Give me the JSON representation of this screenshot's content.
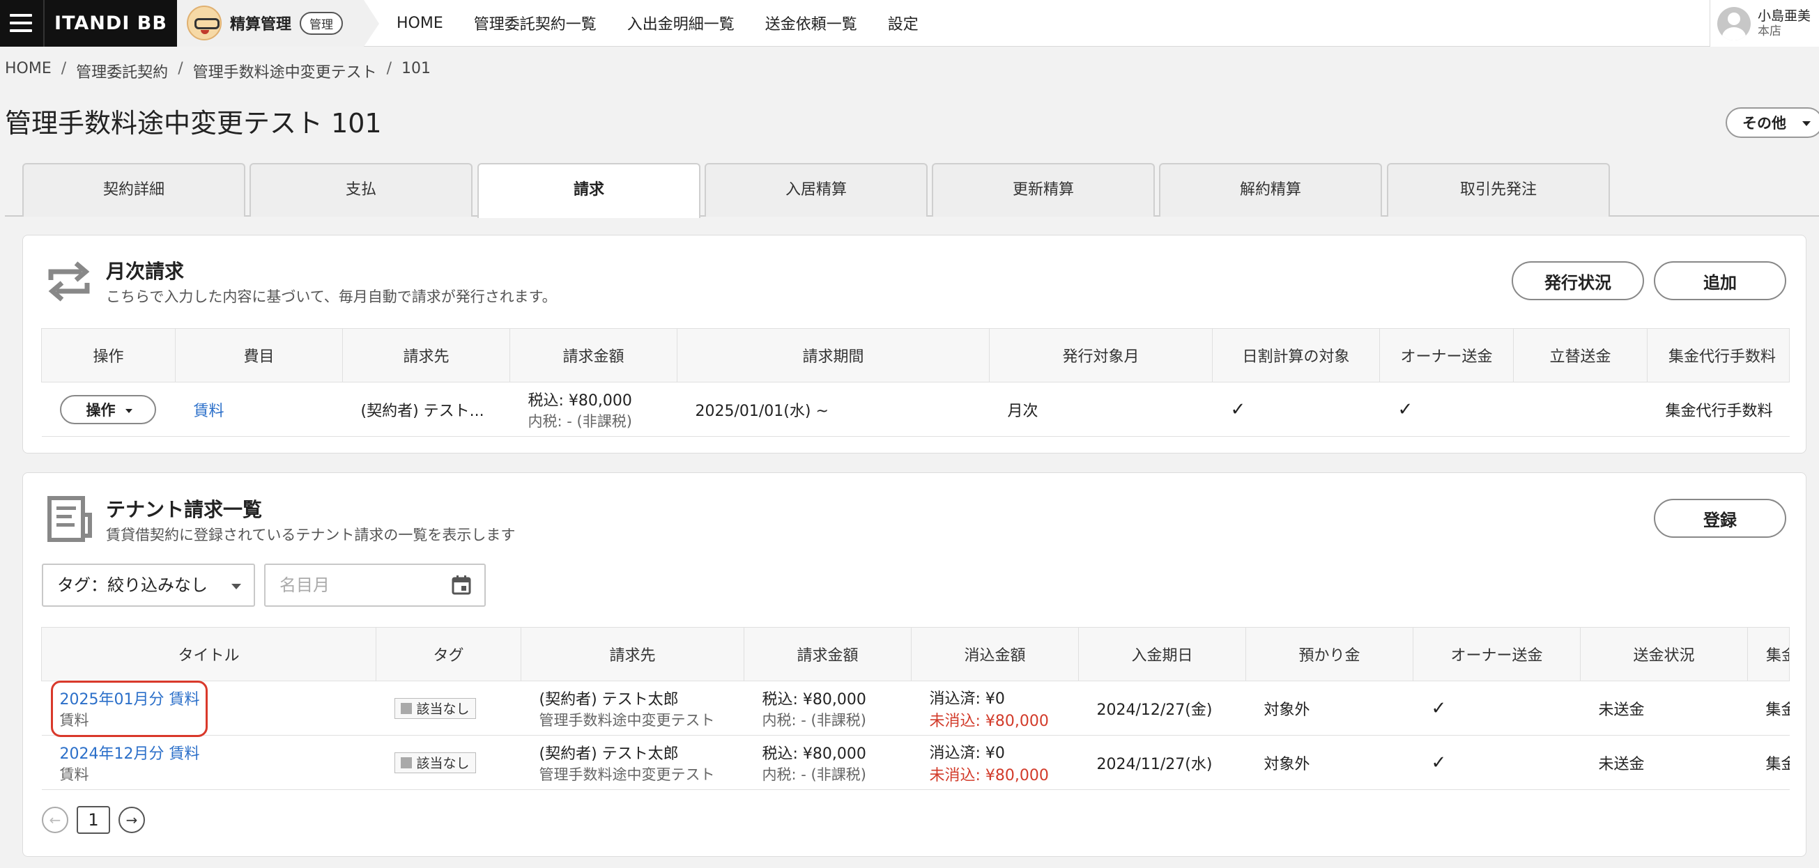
{
  "app": {
    "brand": "ITANDI BB",
    "module_name": "精算管理",
    "module_badge": "管理"
  },
  "topnav": [
    "HOME",
    "管理委託契約一覧",
    "入出金明細一覧",
    "送金依頼一覧",
    "設定"
  ],
  "user": {
    "name": "小島亜美",
    "branch": "本店"
  },
  "breadcrumb": [
    "HOME",
    "管理委託契約",
    "管理手数料途中変更テスト",
    "101"
  ],
  "page_title": "管理手数料途中変更テスト 101",
  "other_button": "その他",
  "tabs": [
    {
      "label": "契約詳細",
      "active": false
    },
    {
      "label": "支払",
      "active": false
    },
    {
      "label": "請求",
      "active": true
    },
    {
      "label": "入居精算",
      "active": false
    },
    {
      "label": "更新精算",
      "active": false
    },
    {
      "label": "解約精算",
      "active": false
    },
    {
      "label": "取引先発注",
      "active": false
    }
  ],
  "monthly": {
    "title": "月次請求",
    "description": "こちらで入力した内容に基づいて、毎月自動で請求が発行されます。",
    "status_button": "発行状況",
    "add_button": "追加",
    "columns": [
      "操作",
      "費目",
      "請求先",
      "請求金額",
      "請求期間",
      "発行対象月",
      "日割計算の対象",
      "オーナー送金",
      "立替送金",
      "集金代行手数料"
    ],
    "row": {
      "ops": "操作",
      "item": "賃料",
      "payer": "(契約者) テスト...",
      "amount": "税込: ¥80,000",
      "amount_sub": "内税: - (非課税)",
      "period": "2025/01/01(水) ~",
      "target_month": "月次",
      "prorate": "✓",
      "owner": "✓",
      "advance": "",
      "fee": "集金代行手数料"
    }
  },
  "tenant": {
    "title": "テナント請求一覧",
    "description": "賃貸借契約に登録されているテナント請求の一覧を表示します",
    "register_button": "登録",
    "tag_filter": "タグ：絞り込みなし",
    "date_placeholder": "名目月",
    "columns": [
      "タイトル",
      "タグ",
      "請求先",
      "請求金額",
      "消込金額",
      "入金期日",
      "預かり金",
      "オーナー送金",
      "送金状況",
      "集金"
    ],
    "rows": [
      {
        "title": "2025年01月分 賃料",
        "title_sub": "賃料",
        "tag": "該当なし",
        "payer": "(契約者) テスト太郎",
        "payer_sub": "管理手数料途中変更テスト",
        "amount": "税込: ¥80,000",
        "amount_sub": "内税: - (非課税)",
        "cleared": "消込済: ¥0",
        "uncleared": "未消込: ¥80,000",
        "due": "2024/12/27(金)",
        "deposit": "対象外",
        "owner": "✓",
        "status": "未送金",
        "fee": "集金"
      },
      {
        "title": "2024年12月分 賃料",
        "title_sub": "賃料",
        "tag": "該当なし",
        "payer": "(契約者) テスト太郎",
        "payer_sub": "管理手数料途中変更テスト",
        "amount": "税込: ¥80,000",
        "amount_sub": "内税: - (非課税)",
        "cleared": "消込済: ¥0",
        "uncleared": "未消込: ¥80,000",
        "due": "2024/11/27(水)",
        "deposit": "対象外",
        "owner": "✓",
        "status": "未送金",
        "fee": "集金"
      }
    ],
    "current_page": "1"
  }
}
